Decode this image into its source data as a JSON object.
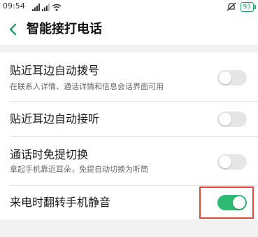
{
  "status_bar": {
    "time": "09:54",
    "battery": "93",
    "icons": [
      "signal-icon",
      "signal-icon",
      "wifi-icon",
      "mute-icon",
      "battery-icon"
    ]
  },
  "header": {
    "back_icon": "chevron-left-icon",
    "title": "智能接打电话"
  },
  "settings": [
    {
      "title": "贴近耳边自动拨号",
      "subtitle": "在联系人详情、通话详情和信息会话界面可用",
      "enabled": false
    },
    {
      "title": "贴近耳边自动接听",
      "subtitle": "",
      "enabled": false
    },
    {
      "title": "通话时免提切换",
      "subtitle": "拿起手机靠近耳朵，免提自动切换为听筒",
      "enabled": false
    },
    {
      "title": "来电时翻转手机静音",
      "subtitle": "",
      "enabled": true
    }
  ],
  "colors": {
    "accent_green": "#2fba73",
    "highlight_red": "#e14a3b",
    "back_green": "#22a06b"
  }
}
